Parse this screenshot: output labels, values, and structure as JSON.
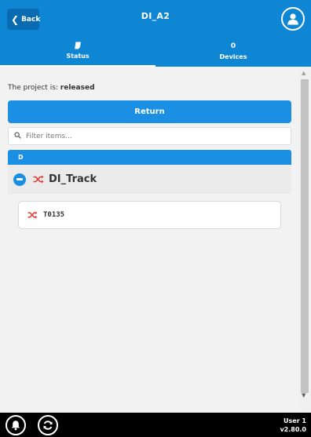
{
  "header": {
    "back_label": "Back",
    "title": "DI_A2",
    "user_icon": "user-icon"
  },
  "tabs": [
    {
      "label": "Status",
      "icon": "document-icon",
      "active": true
    },
    {
      "label": "Devices",
      "count": "0",
      "active": false
    }
  ],
  "main": {
    "project_prefix": "The project is:",
    "project_status": "released",
    "return_label": "Return",
    "filter": {
      "placeholder": "Filter items...",
      "value": ""
    },
    "group_header": "D",
    "group": {
      "name": "DI_Track",
      "icon": "shuffle-icon",
      "collapse_icon": "minus-circle-icon"
    },
    "devices": [
      {
        "name": "T0135",
        "icon": "shuffle-icon"
      }
    ]
  },
  "footer": {
    "bell_icon": "bell-icon",
    "refresh_icon": "refresh-icon",
    "user": "User 1",
    "version": "v2.80.0"
  },
  "colors": {
    "primary": "#0e86d4",
    "button": "#1a8fe3",
    "accent_red": "#e53935",
    "footer_bg": "#000000",
    "content_bg": "#f2f2f2"
  }
}
